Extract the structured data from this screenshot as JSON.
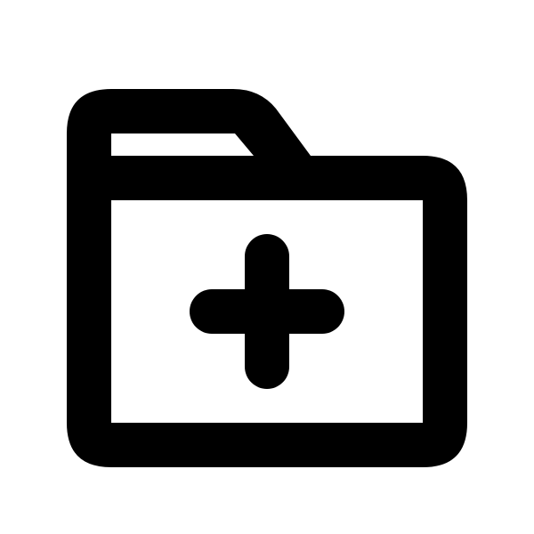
{
  "icon": {
    "name": "folder-add-icon",
    "stroke_color": "#000000",
    "background_color": "#ffffff"
  }
}
